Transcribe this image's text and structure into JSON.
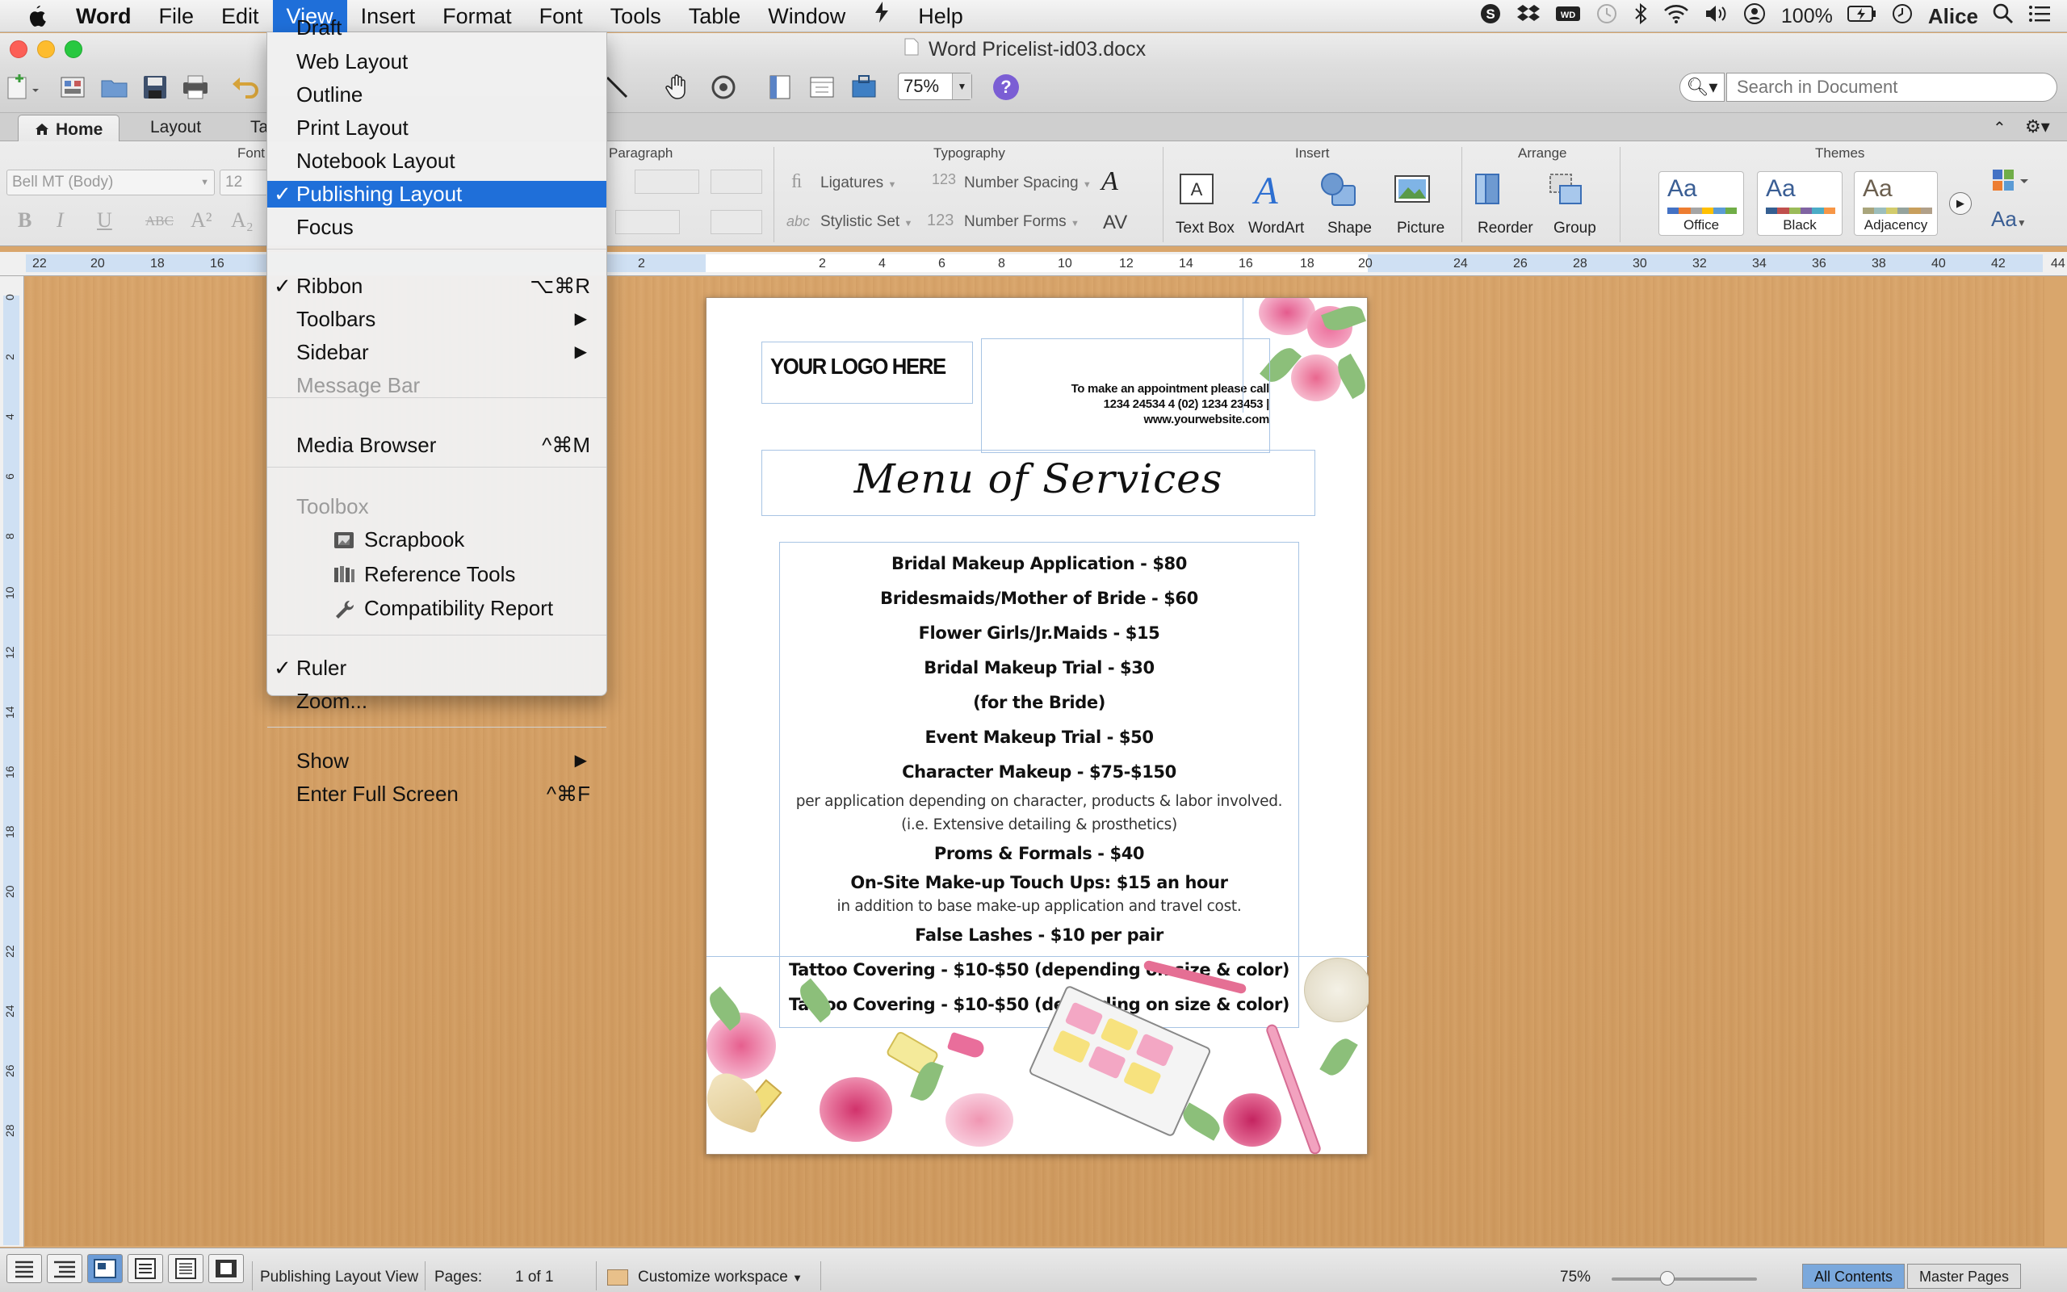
{
  "menubar": {
    "items": [
      "Word",
      "File",
      "Edit",
      "View",
      "Insert",
      "Format",
      "Font",
      "Tools",
      "Table",
      "Window",
      "Help"
    ],
    "battery": "100%",
    "user": "Alice"
  },
  "window": {
    "title": "Word Pricelist-id03.docx"
  },
  "toolbar": {
    "zoom": "75%",
    "search_placeholder": "Search in Document"
  },
  "ribbon": {
    "tabs": [
      "Home",
      "Layout",
      "Ta"
    ],
    "groups": {
      "font": "Font",
      "paragraph": "Paragraph",
      "typography": "Typography",
      "insert": "Insert",
      "arrange": "Arrange",
      "themes": "Themes"
    },
    "font_name": "Bell MT (Body)",
    "font_size": "12",
    "typography": {
      "ligatures": "Ligatures",
      "number_spacing": "Number Spacing",
      "stylistic_set": "Stylistic Set",
      "number_forms": "Number Forms"
    },
    "insert_buttons": [
      "Text Box",
      "WordArt",
      "Shape",
      "Picture"
    ],
    "arrange_buttons": [
      "Reorder",
      "Group"
    ],
    "themes": [
      "Office",
      "Black",
      "Adjacency"
    ],
    "theme_aa": "Aa"
  },
  "view_menu": {
    "items": [
      {
        "label": "Draft"
      },
      {
        "label": "Web Layout"
      },
      {
        "label": "Outline"
      },
      {
        "label": "Print Layout"
      },
      {
        "label": "Notebook Layout"
      },
      {
        "label": "Publishing Layout",
        "checked": true,
        "selected": true
      },
      {
        "label": "Focus"
      },
      {
        "label": "Ribbon",
        "checked": true,
        "shortcut": "⌥⌘R"
      },
      {
        "label": "Toolbars",
        "submenu": true
      },
      {
        "label": "Sidebar",
        "submenu": true
      },
      {
        "label": "Message Bar",
        "disabled": true
      },
      {
        "label": "Media Browser",
        "shortcut": "^⌘M"
      },
      {
        "label": "Toolbox",
        "disabled": true
      },
      {
        "label": "Scrapbook",
        "icon": "scrapbook-icon"
      },
      {
        "label": "Reference Tools",
        "icon": "reference-tools-icon"
      },
      {
        "label": "Compatibility Report",
        "icon": "wrench-icon"
      },
      {
        "label": "Ruler",
        "checked": true
      },
      {
        "label": "Zoom..."
      },
      {
        "label": "Show",
        "submenu": true
      },
      {
        "label": "Enter Full Screen",
        "shortcut": "^⌘F"
      }
    ],
    "check_mark": "✓"
  },
  "ruler": {
    "h_labels": [
      "22",
      "20",
      "18",
      "16",
      "2",
      "2",
      "4",
      "6",
      "8",
      "10",
      "12",
      "14",
      "16",
      "18",
      "20",
      "24",
      "26",
      "28",
      "30",
      "32",
      "34",
      "36",
      "38",
      "40",
      "42",
      "44"
    ],
    "v_labels": [
      "0",
      "2",
      "4",
      "6",
      "8",
      "10",
      "12",
      "14",
      "16",
      "18",
      "20",
      "22",
      "24",
      "26",
      "28"
    ]
  },
  "document": {
    "logo": "YOUR LOGO HERE",
    "contact_lines": [
      "To make an appointment please call",
      "1234 24534 4 (02) 1234 23453 |",
      "www.yourwebsite.com"
    ],
    "menu_title": "Menu of Services",
    "services": [
      {
        "text": "Bridal Makeup Application - $80",
        "bold": true
      },
      {
        "text": "Bridesmaids/Mother of Bride - $60",
        "bold": true
      },
      {
        "text": "Flower Girls/Jr.Maids - $15",
        "bold": true
      },
      {
        "text": "Bridal Makeup Trial - $30",
        "bold": true
      },
      {
        "text": "(for the Bride)",
        "bold": true
      },
      {
        "text": "Event Makeup Trial - $50",
        "bold": true
      },
      {
        "text": "Character Makeup - $75-$150",
        "bold": true
      },
      {
        "text": "per application depending on character, products & labor involved.",
        "bold": false
      },
      {
        "text": "(i.e. Extensive detailing & prosthetics)",
        "bold": false
      },
      {
        "text": "Proms & Formals - $40",
        "bold": true,
        "tight": true
      },
      {
        "text": "On-Site Make-up Touch Ups: $15 an hour",
        "bold": true,
        "tight": true
      },
      {
        "text": "in addition to base make-up application and travel cost.",
        "bold": false
      },
      {
        "text": "False Lashes - $10 per pair",
        "bold": true
      },
      {
        "text": "Tattoo Covering - $10-$50 (depending on size & color)",
        "bold": true
      },
      {
        "text": "Tattoo Covering - $10-$50 (depending on size & color)",
        "bold": true
      }
    ]
  },
  "statusbar": {
    "view_name": "Publishing Layout View",
    "pages_label": "Pages:",
    "pages_value": "1 of 1",
    "workspace": "Customize workspace",
    "zoom": "75%",
    "all_contents": "All Contents",
    "master_pages": "Master Pages"
  },
  "colors": {
    "menu_highlight": "#1f6fd9",
    "desk": "#d9a66c"
  }
}
